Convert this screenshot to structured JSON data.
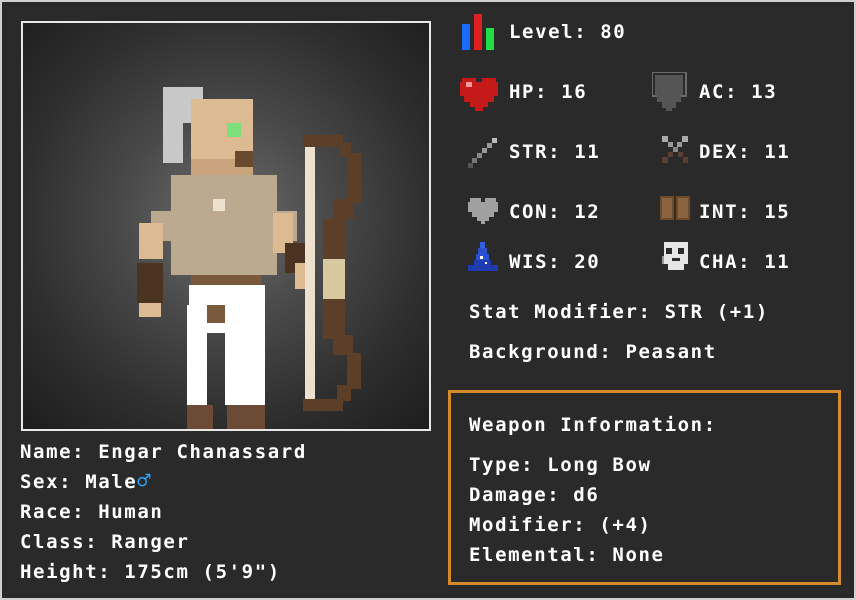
{
  "character": {
    "name_line": "Name: Engar Chanassard",
    "sex_line": "Sex: Male",
    "sex_symbol": "♂",
    "race_line": "Race: Human",
    "class_line": "Class: Ranger",
    "height_line": "Height: 175cm (5'9\")"
  },
  "stats": {
    "level": "Level: 80",
    "hp": "HP: 16",
    "ac": "AC: 13",
    "str": "STR: 11",
    "dex": "DEX: 11",
    "con": "CON: 12",
    "int": "INT: 15",
    "wis": "WIS: 20",
    "cha": "CHA: 11",
    "stat_modifier": "Stat Modifier: STR (+1)",
    "background": "Background: Peasant"
  },
  "weapon": {
    "heading": "Weapon Information:",
    "type": "Type: Long Bow",
    "damage": "Damage: d6",
    "modifier": "Modifier: (+4)",
    "elemental": "Elemental: None"
  },
  "icons": {
    "level": "bar-chart-icon",
    "hp": "heart-icon",
    "ac": "shield-icon",
    "str": "sword-icon",
    "dex": "crossed-daggers-icon",
    "con": "grey-heart-icon",
    "int": "book-icon",
    "wis": "wizard-hat-icon",
    "cha": "mask-icon"
  },
  "colors": {
    "background": "#2a2a2a",
    "frame": "#cfcfcf",
    "weapon_box_border": "#d68a2e",
    "sex_symbol": "#29a8ff"
  }
}
